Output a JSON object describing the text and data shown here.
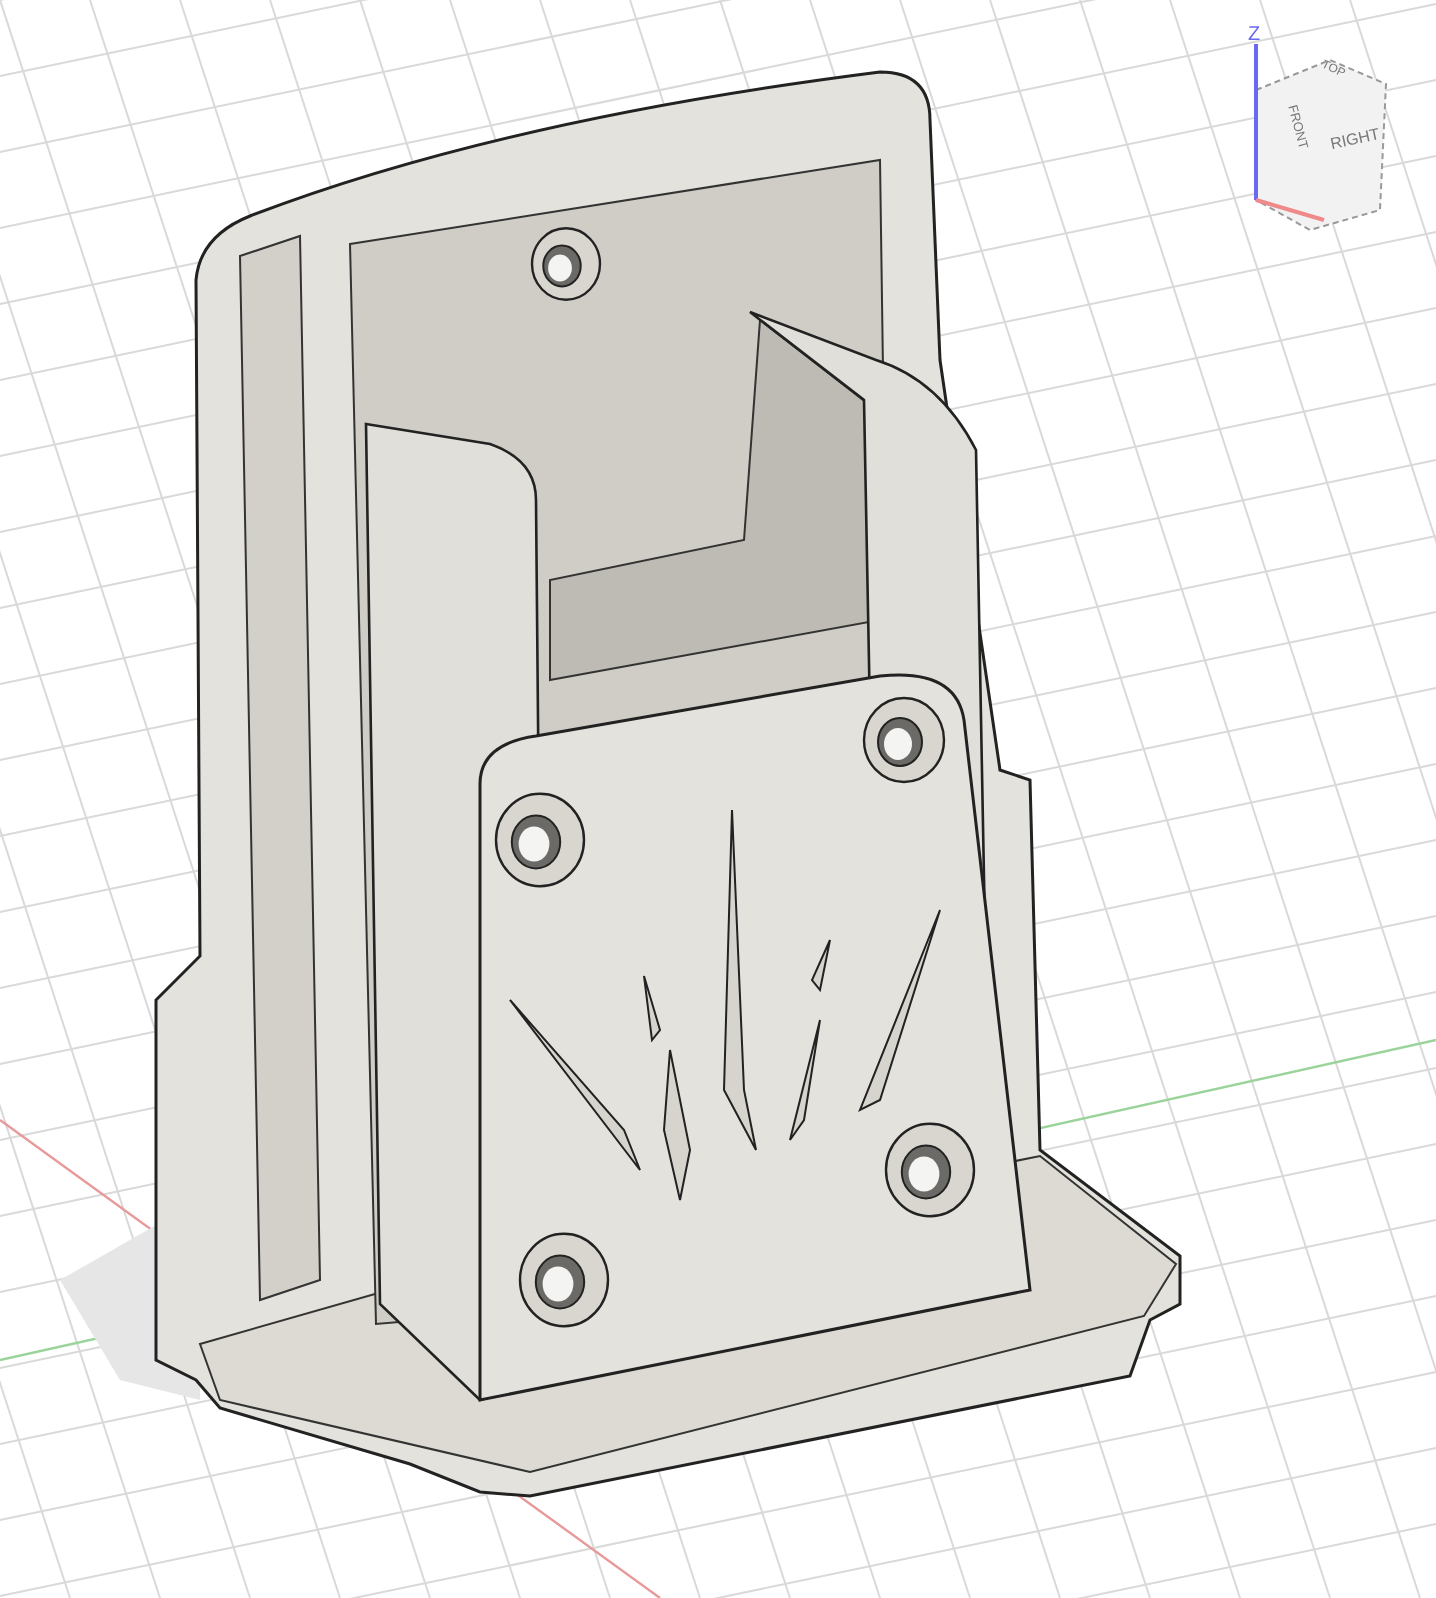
{
  "viewcube": {
    "axis_label": "Z",
    "faces": [
      {
        "kind": "top",
        "label": "TOP"
      },
      {
        "kind": "front",
        "label": "FRONT"
      },
      {
        "kind": "right",
        "label": "RIGHT"
      }
    ]
  }
}
